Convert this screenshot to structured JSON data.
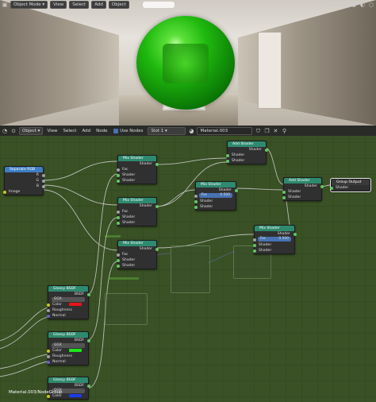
{
  "viewport_header": {
    "mode": "Object Mode",
    "menus": [
      "View",
      "Select",
      "Add",
      "Object"
    ]
  },
  "node_header": {
    "editor_type": "Object",
    "menus": [
      "View",
      "Select",
      "Add",
      "Node"
    ],
    "use_nodes_label": "Use Nodes",
    "slot": "Slot 1",
    "material": "Material.003"
  },
  "nodes": {
    "separate_rgb": {
      "title": "Separate RGB",
      "r": "R",
      "g": "G",
      "b": "B",
      "image": "Image"
    },
    "mix1": {
      "title": "Mix Shader",
      "out": "Shader",
      "fac": "Fac",
      "s1": "Shader",
      "s2": "Shader"
    },
    "mix2": {
      "title": "Mix Shader",
      "out": "Shader",
      "fac": "Fac",
      "s1": "Shader",
      "s2": "Shader"
    },
    "mix3": {
      "title": "Mix Shader",
      "out": "Shader",
      "fac": "Fac",
      "s1": "Shader",
      "s2": "Shader"
    },
    "mix4": {
      "title": "Mix Shader",
      "out": "Shader",
      "fac": "Fac",
      "fac_value": "0.500",
      "s1": "Shader",
      "s2": "Shader"
    },
    "mix5": {
      "title": "Mix Shader",
      "out": "Shader",
      "fac": "Fac",
      "fac_value": "0.500",
      "s1": "Shader",
      "s2": "Shader"
    },
    "add1": {
      "title": "Add Shader",
      "out": "Shader",
      "s1": "Shader",
      "s2": "Shader"
    },
    "add2": {
      "title": "Add Shader",
      "out": "Shader",
      "s1": "Shader",
      "s2": "Shader"
    },
    "group_output": {
      "title": "Group Output",
      "s1": "Shader"
    },
    "glossy1": {
      "title": "Glossy BSDF",
      "out": "BSDF",
      "dist": "GGX",
      "color": "Color",
      "roughness": "Roughness",
      "normal": "Normal",
      "swatch": "#e8141a"
    },
    "glossy2": {
      "title": "Glossy BSDF",
      "out": "BSDF",
      "dist": "GGX",
      "color": "Color",
      "roughness": "Roughness",
      "normal": "Normal",
      "swatch": "#1ee81a"
    },
    "glossy3": {
      "title": "Glossy BSDF",
      "out": "BSDF",
      "dist": "GGX",
      "color": "Color",
      "swatch": "#1a3ce8"
    }
  },
  "footer": {
    "breadcrumb": "Material.003/NodeGroup"
  },
  "colors": {
    "shader_header": "#2e8a6e",
    "converter_header": "#3f7ec3",
    "editor_bg": "#395125"
  }
}
